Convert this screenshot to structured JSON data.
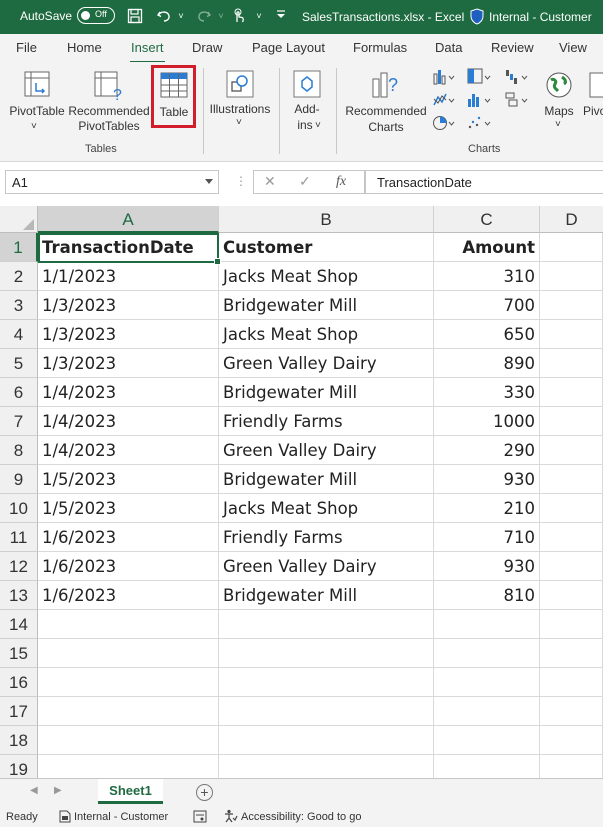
{
  "titlebar": {
    "autosave_label": "AutoSave",
    "autosave_state": "Off",
    "filename": "SalesTransactions.xlsx  -  Excel",
    "sensitivity": "Internal - Customer"
  },
  "ribbon_tabs": [
    "File",
    "Home",
    "Insert",
    "Draw",
    "Page Layout",
    "Formulas",
    "Data",
    "Review",
    "View"
  ],
  "active_tab": "Insert",
  "ribbon": {
    "pivottable": "PivotTable",
    "pivottable_arrow": "˅",
    "rec_pivot_1": "Recommended",
    "rec_pivot_2": "PivotTables",
    "table": "Table",
    "tables_group": "Tables",
    "illustrations": "Illustrations",
    "addins_1": "Add-",
    "addins_2": "ins",
    "rec_charts_1": "Recommended",
    "rec_charts_2": "Charts",
    "maps": "Maps",
    "pivot_partial": "Pivo",
    "charts_group": "Charts"
  },
  "formula_bar": {
    "name_box": "A1",
    "fx": "fx",
    "content": "TransactionDate"
  },
  "columns": [
    "A",
    "B",
    "C",
    "D"
  ],
  "rows": [
    "1",
    "2",
    "3",
    "4",
    "5",
    "6",
    "7",
    "8",
    "9",
    "10",
    "11",
    "12",
    "13",
    "14",
    "15",
    "16",
    "17",
    "18",
    "19"
  ],
  "table": {
    "headers": [
      "TransactionDate",
      "Customer",
      "Amount"
    ],
    "data": [
      [
        "1/1/2023",
        "Jacks Meat Shop",
        "310"
      ],
      [
        "1/3/2023",
        "Bridgewater Mill",
        "700"
      ],
      [
        "1/3/2023",
        "Jacks Meat Shop",
        "650"
      ],
      [
        "1/3/2023",
        "Green Valley Dairy",
        "890"
      ],
      [
        "1/4/2023",
        "Bridgewater Mill",
        "330"
      ],
      [
        "1/4/2023",
        "Friendly Farms",
        "1000"
      ],
      [
        "1/4/2023",
        "Green Valley Dairy",
        "290"
      ],
      [
        "1/5/2023",
        "Bridgewater Mill",
        "930"
      ],
      [
        "1/5/2023",
        "Jacks Meat Shop",
        "210"
      ],
      [
        "1/6/2023",
        "Friendly Farms",
        "710"
      ],
      [
        "1/6/2023",
        "Green Valley Dairy",
        "930"
      ],
      [
        "1/6/2023",
        "Bridgewater Mill",
        "810"
      ]
    ]
  },
  "sheet_tab": "Sheet1",
  "add_sheet": "+",
  "statusbar": {
    "ready": "Ready",
    "sensitivity": "Internal - Customer",
    "accessibility": "Accessibility: Good to go"
  }
}
